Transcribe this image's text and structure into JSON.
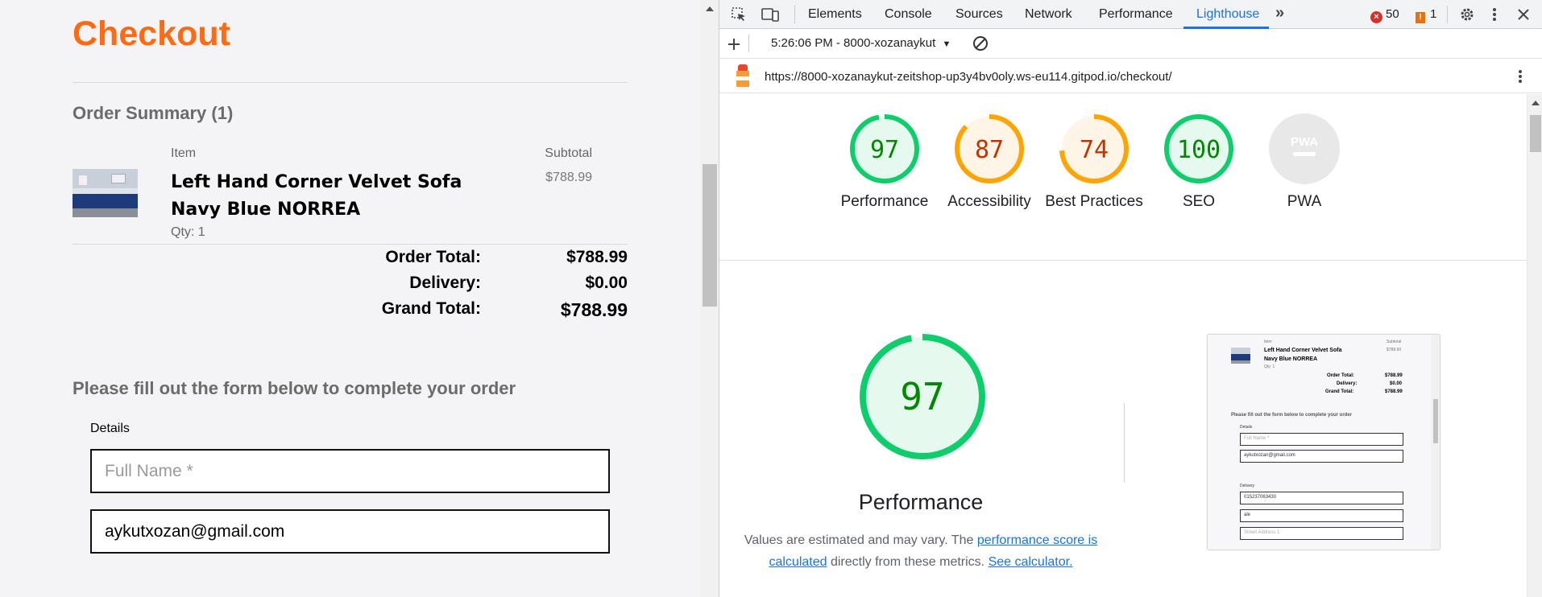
{
  "checkout": {
    "title": "Checkout",
    "order_summary": "Order Summary (1)",
    "col_item": "Item",
    "col_subtotal": "Subtotal",
    "product_name": "Left Hand Corner Velvet Sofa Navy Blue NORREA",
    "product_price": "$788.99",
    "qty": "Qty: 1",
    "order_total_label": "Order Total:",
    "order_total_value": "$788.99",
    "delivery_label": "Delivery:",
    "delivery_value": "$0.00",
    "grand_total_label": "Grand Total:",
    "grand_total_value": "$788.99",
    "form_heading": "Please fill out the form below to complete your order",
    "details_label": "Details",
    "full_name_placeholder": "Full Name *",
    "email_value": "aykutxozan@gmail.com"
  },
  "devtools": {
    "tabs": [
      "Elements",
      "Console",
      "Sources",
      "Network",
      "Performance",
      "Lighthouse"
    ],
    "active_tab": "Lighthouse",
    "error_count": "50",
    "warning_count": "1",
    "report_selector": "5:26:06 PM - 8000-xozanaykut",
    "url": "https://8000-xozanaykut-zeitshop-up3y4bv0oly.ws-eu114.gitpod.io/checkout/",
    "icons": [
      "inspect-icon",
      "device-toolbar-icon",
      "more-tabs-icon",
      "settings-icon",
      "kebab-menu-icon",
      "close-icon",
      "plus-icon",
      "clear-icon",
      "lighthouse-logo"
    ]
  },
  "lighthouse": {
    "gauges": [
      {
        "label": "Performance",
        "score": "97",
        "value": 97,
        "color": "#0cce6b",
        "fill": "#e6f9ee",
        "text_color": "#008800"
      },
      {
        "label": "Accessibility",
        "score": "87",
        "value": 87,
        "color": "#ffa400",
        "fill": "#fff5e6",
        "text_color": "#c33300"
      },
      {
        "label": "Best Practices",
        "score": "74",
        "value": 74,
        "color": "#ffa400",
        "fill": "#fff5e6",
        "text_color": "#c33300"
      },
      {
        "label": "SEO",
        "score": "100",
        "value": 100,
        "color": "#0cce6b",
        "fill": "#e6f9ee",
        "text_color": "#008800"
      },
      {
        "label": "PWA",
        "score": "PWA",
        "value": 0,
        "color": "#cccccc",
        "fill": "#e8e8e8",
        "text_color": "#ffffff"
      }
    ],
    "big_score": "97",
    "big_title": "Performance",
    "disclaimer_pre": "Values are estimated and may vary. The ",
    "disclaimer_link1": "performance score is calculated",
    "disclaimer_mid": " directly from these metrics. ",
    "disclaimer_link2": "See calculator."
  },
  "screenshot_thumb": {
    "item": "Item",
    "subtotal": "Subtotal",
    "product_line1": "Left Hand Corner Velvet Sofa",
    "product_line2": "Navy Blue NORREA",
    "price": "$788.99",
    "qty": "Qty: 1",
    "order_total": "Order Total:",
    "order_total_val": "$788.99",
    "delivery": "Delivery:",
    "delivery_val": "$0.00",
    "grand_total": "Grand Total:",
    "grand_total_val": "$788.99",
    "form_heading": "Please fill out the form below to complete your order",
    "details": "Details",
    "full_name": "Full Name *",
    "email": "aykutxozan@gmail.com",
    "delivery_section": "Delivery",
    "phone": "015237063430",
    "town": "ale",
    "street": "Street Address 1"
  }
}
